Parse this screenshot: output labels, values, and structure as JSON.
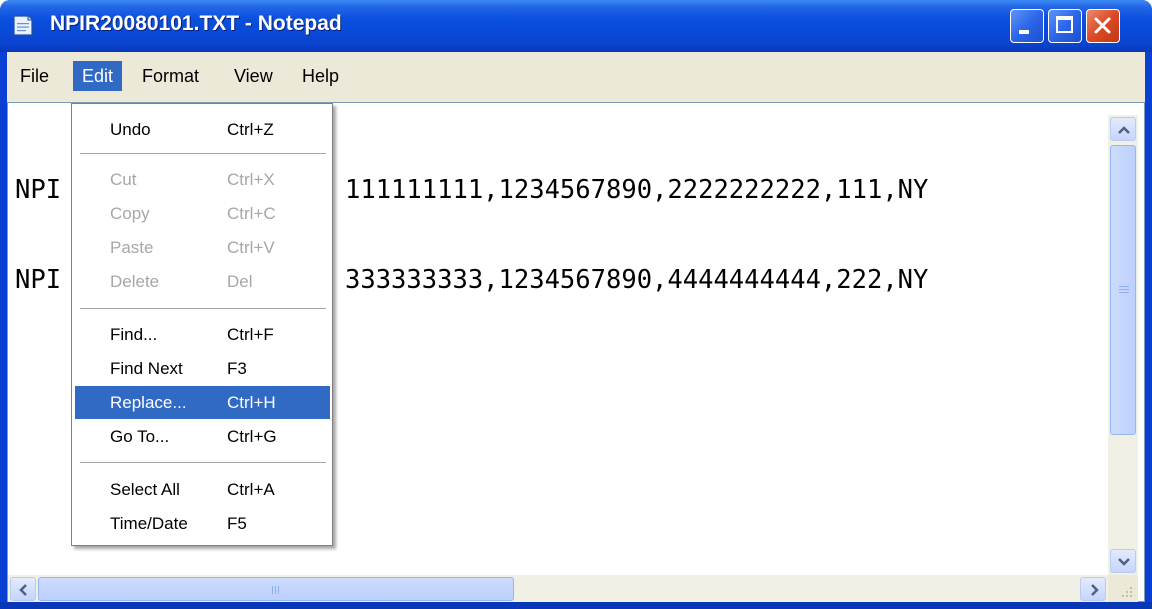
{
  "window": {
    "title": "NPIR20080101.TXT - Notepad",
    "colors": {
      "title_blue": "#0a48d6",
      "menu_bg": "#ece9d8",
      "highlight": "#316ac5",
      "close_red": "#db4a26"
    }
  },
  "menubar": {
    "items": [
      "File",
      "Edit",
      "Format",
      "View",
      "Help"
    ],
    "active": "Edit"
  },
  "editor": {
    "lines": [
      "NPI",
      "NPI"
    ],
    "lines_right": [
      "111111111,1234567890,2222222222,111,NY",
      "333333333,1234567890,4444444444,222,NY"
    ]
  },
  "edit_menu": {
    "items": [
      {
        "label": "Undo",
        "shortcut": "Ctrl+Z",
        "enabled": true
      },
      {
        "label": "Cut",
        "shortcut": "Ctrl+X",
        "enabled": false
      },
      {
        "label": "Copy",
        "shortcut": "Ctrl+C",
        "enabled": false
      },
      {
        "label": "Paste",
        "shortcut": "Ctrl+V",
        "enabled": false
      },
      {
        "label": "Delete",
        "shortcut": "Del",
        "enabled": false
      },
      {
        "label": "Find...",
        "shortcut": "Ctrl+F",
        "enabled": true
      },
      {
        "label": "Find Next",
        "shortcut": "F3",
        "enabled": true
      },
      {
        "label": "Replace...",
        "shortcut": "Ctrl+H",
        "enabled": true,
        "highlighted": true
      },
      {
        "label": "Go To...",
        "shortcut": "Ctrl+G",
        "enabled": true
      },
      {
        "label": "Select All",
        "shortcut": "Ctrl+A",
        "enabled": true
      },
      {
        "label": "Time/Date",
        "shortcut": "F5",
        "enabled": true
      }
    ]
  }
}
